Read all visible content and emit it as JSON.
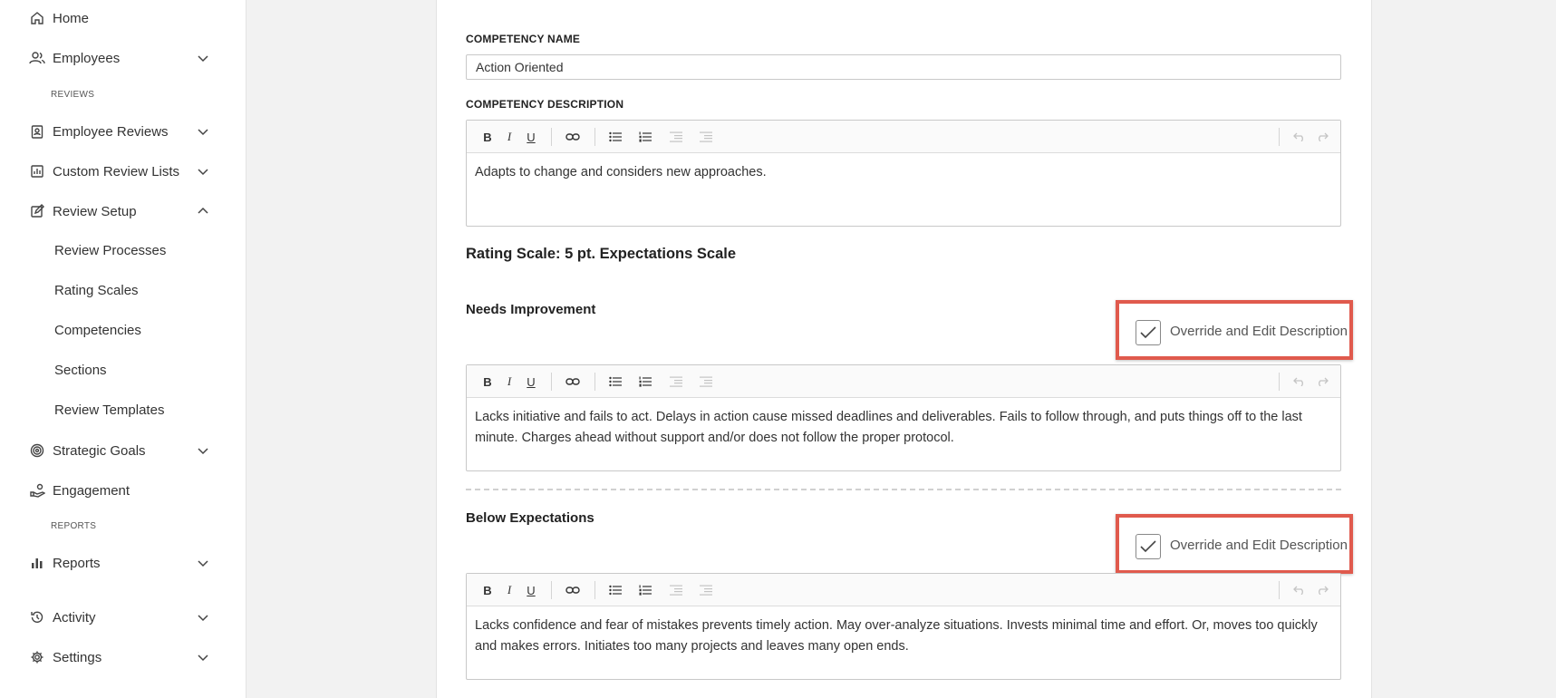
{
  "sidebar": {
    "items": [
      {
        "label": "Home",
        "icon": "home-icon"
      },
      {
        "label": "Employees",
        "icon": "users-icon"
      },
      {
        "label": "Employee Reviews",
        "icon": "clipboard-user-icon"
      },
      {
        "label": "Custom Review Lists",
        "icon": "chart-list-icon"
      },
      {
        "label": "Review Setup",
        "icon": "edit-square-icon"
      },
      {
        "label": "Strategic Goals",
        "icon": "target-icon"
      },
      {
        "label": "Engagement",
        "icon": "engagement-icon"
      },
      {
        "label": "Reports",
        "icon": "bar-chart-icon"
      },
      {
        "label": "Activity",
        "icon": "history-icon"
      },
      {
        "label": "Settings",
        "icon": "gear-icon"
      }
    ],
    "sections": {
      "reviews": "REVIEWS",
      "reports": "REPORTS"
    },
    "review_setup_sub": [
      "Review Processes",
      "Rating Scales",
      "Competencies",
      "Sections",
      "Review Templates"
    ]
  },
  "form": {
    "competency_name_label": "COMPETENCY NAME",
    "competency_name_value": "Action Oriented",
    "competency_description_label": "COMPETENCY DESCRIPTION",
    "competency_description_value": "Adapts to change and considers new approaches.",
    "rating_scale_heading": "Rating Scale: 5 pt. Expectations Scale",
    "levels": [
      {
        "name": "Needs Improvement",
        "override_label": "Override and Edit Description",
        "override_checked": true,
        "description": "Lacks initiative and fails to act. Delays in action cause missed deadlines and deliverables.  Fails to follow through, and puts things off to the last minute. Charges ahead without support and/or does not follow the proper protocol."
      },
      {
        "name": "Below Expectations",
        "override_label": "Override and Edit Description",
        "override_checked": true,
        "description": "Lacks confidence and fear of mistakes prevents timely action. May over-analyze situations.  Invests minimal time and effort. Or, moves too quickly and makes errors. Initiates too many projects and leaves many open ends."
      }
    ],
    "toolbar": {
      "bold": "B",
      "italic": "I",
      "underline": "U"
    }
  },
  "colors": {
    "highlight": "#e05a4d",
    "sidebar_bg": "#ffffff",
    "page_bg": "#f2f2f2"
  }
}
